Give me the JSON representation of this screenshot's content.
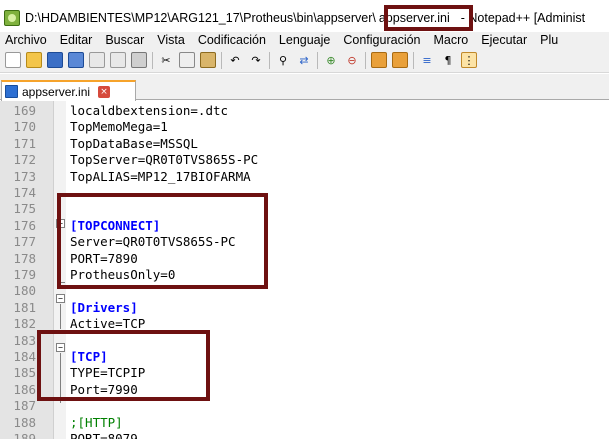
{
  "window": {
    "title_path": "D:\\HDAMBIENTES\\MP12\\ARG121_17\\Protheus\\bin\\appserver\\",
    "title_file": "appserver.ini",
    "title_app": "- Notepad++ [Administ"
  },
  "menu": {
    "items": [
      {
        "label": "Archivo"
      },
      {
        "label": "Editar"
      },
      {
        "label": "Buscar"
      },
      {
        "label": "Vista"
      },
      {
        "label": "Codificación"
      },
      {
        "label": "Lenguaje"
      },
      {
        "label": "Configuración"
      },
      {
        "label": "Macro"
      },
      {
        "label": "Ejecutar"
      },
      {
        "label": "Plu"
      }
    ]
  },
  "toolbar": {
    "buttons": [
      "new-file-icon",
      "open-file-icon",
      "save-icon",
      "save-all-icon",
      "close-icon",
      "close-all-icon",
      "print-icon",
      "cut-icon",
      "copy-icon",
      "paste-icon",
      "undo-icon",
      "redo-icon",
      "find-icon",
      "replace-icon",
      "zoom-in-icon",
      "zoom-out-icon",
      "sync-vertical-icon",
      "sync-horizontal-icon",
      "word-wrap-icon",
      "show-all-chars-icon",
      "indent-guide-icon"
    ]
  },
  "tab": {
    "label": "appserver.ini",
    "close_symbol": "×"
  },
  "editor": {
    "lines": [
      {
        "num": "169",
        "text": "localdbextension=.dtc",
        "kind": "kv"
      },
      {
        "num": "170",
        "text": "TopMemoMega=1",
        "kind": "kv"
      },
      {
        "num": "171",
        "text": "TopDataBase=MSSQL",
        "kind": "kv"
      },
      {
        "num": "172",
        "text": "TopServer=QR0T0TVS865S-PC",
        "kind": "kv"
      },
      {
        "num": "173",
        "text": "TopALIAS=MP12_17BIOFARMA",
        "kind": "kv"
      },
      {
        "num": "174",
        "text": "",
        "kind": "blank"
      },
      {
        "num": "175",
        "text": "",
        "kind": "blank"
      },
      {
        "num": "176",
        "text": "[TOPCONNECT]",
        "kind": "section"
      },
      {
        "num": "177",
        "text": "Server=QR0T0TVS865S-PC",
        "kind": "kv"
      },
      {
        "num": "178",
        "text": "PORT=7890",
        "kind": "kv"
      },
      {
        "num": "179",
        "text": "ProtheusOnly=0",
        "kind": "kv"
      },
      {
        "num": "180",
        "text": "",
        "kind": "blank"
      },
      {
        "num": "181",
        "text": "[Drivers]",
        "kind": "section"
      },
      {
        "num": "182",
        "text": "Active=TCP",
        "kind": "kv"
      },
      {
        "num": "183",
        "text": "",
        "kind": "blank"
      },
      {
        "num": "184",
        "text": "[TCP]",
        "kind": "section"
      },
      {
        "num": "185",
        "text": "TYPE=TCPIP",
        "kind": "kv"
      },
      {
        "num": "186",
        "text": "Port=7990",
        "kind": "kv"
      },
      {
        "num": "187",
        "text": "",
        "kind": "blank"
      },
      {
        "num": "188",
        "text": ";[HTTP]",
        "kind": "comment"
      },
      {
        "num": "189",
        "text": "PORT=8079",
        "kind": "kv"
      }
    ]
  },
  "colors": {
    "highlight_border": "#6e1111",
    "section": "#0000ff",
    "comment": "#008000",
    "line_number": "#8a8a8a",
    "tab_accent": "#f6a32b"
  }
}
